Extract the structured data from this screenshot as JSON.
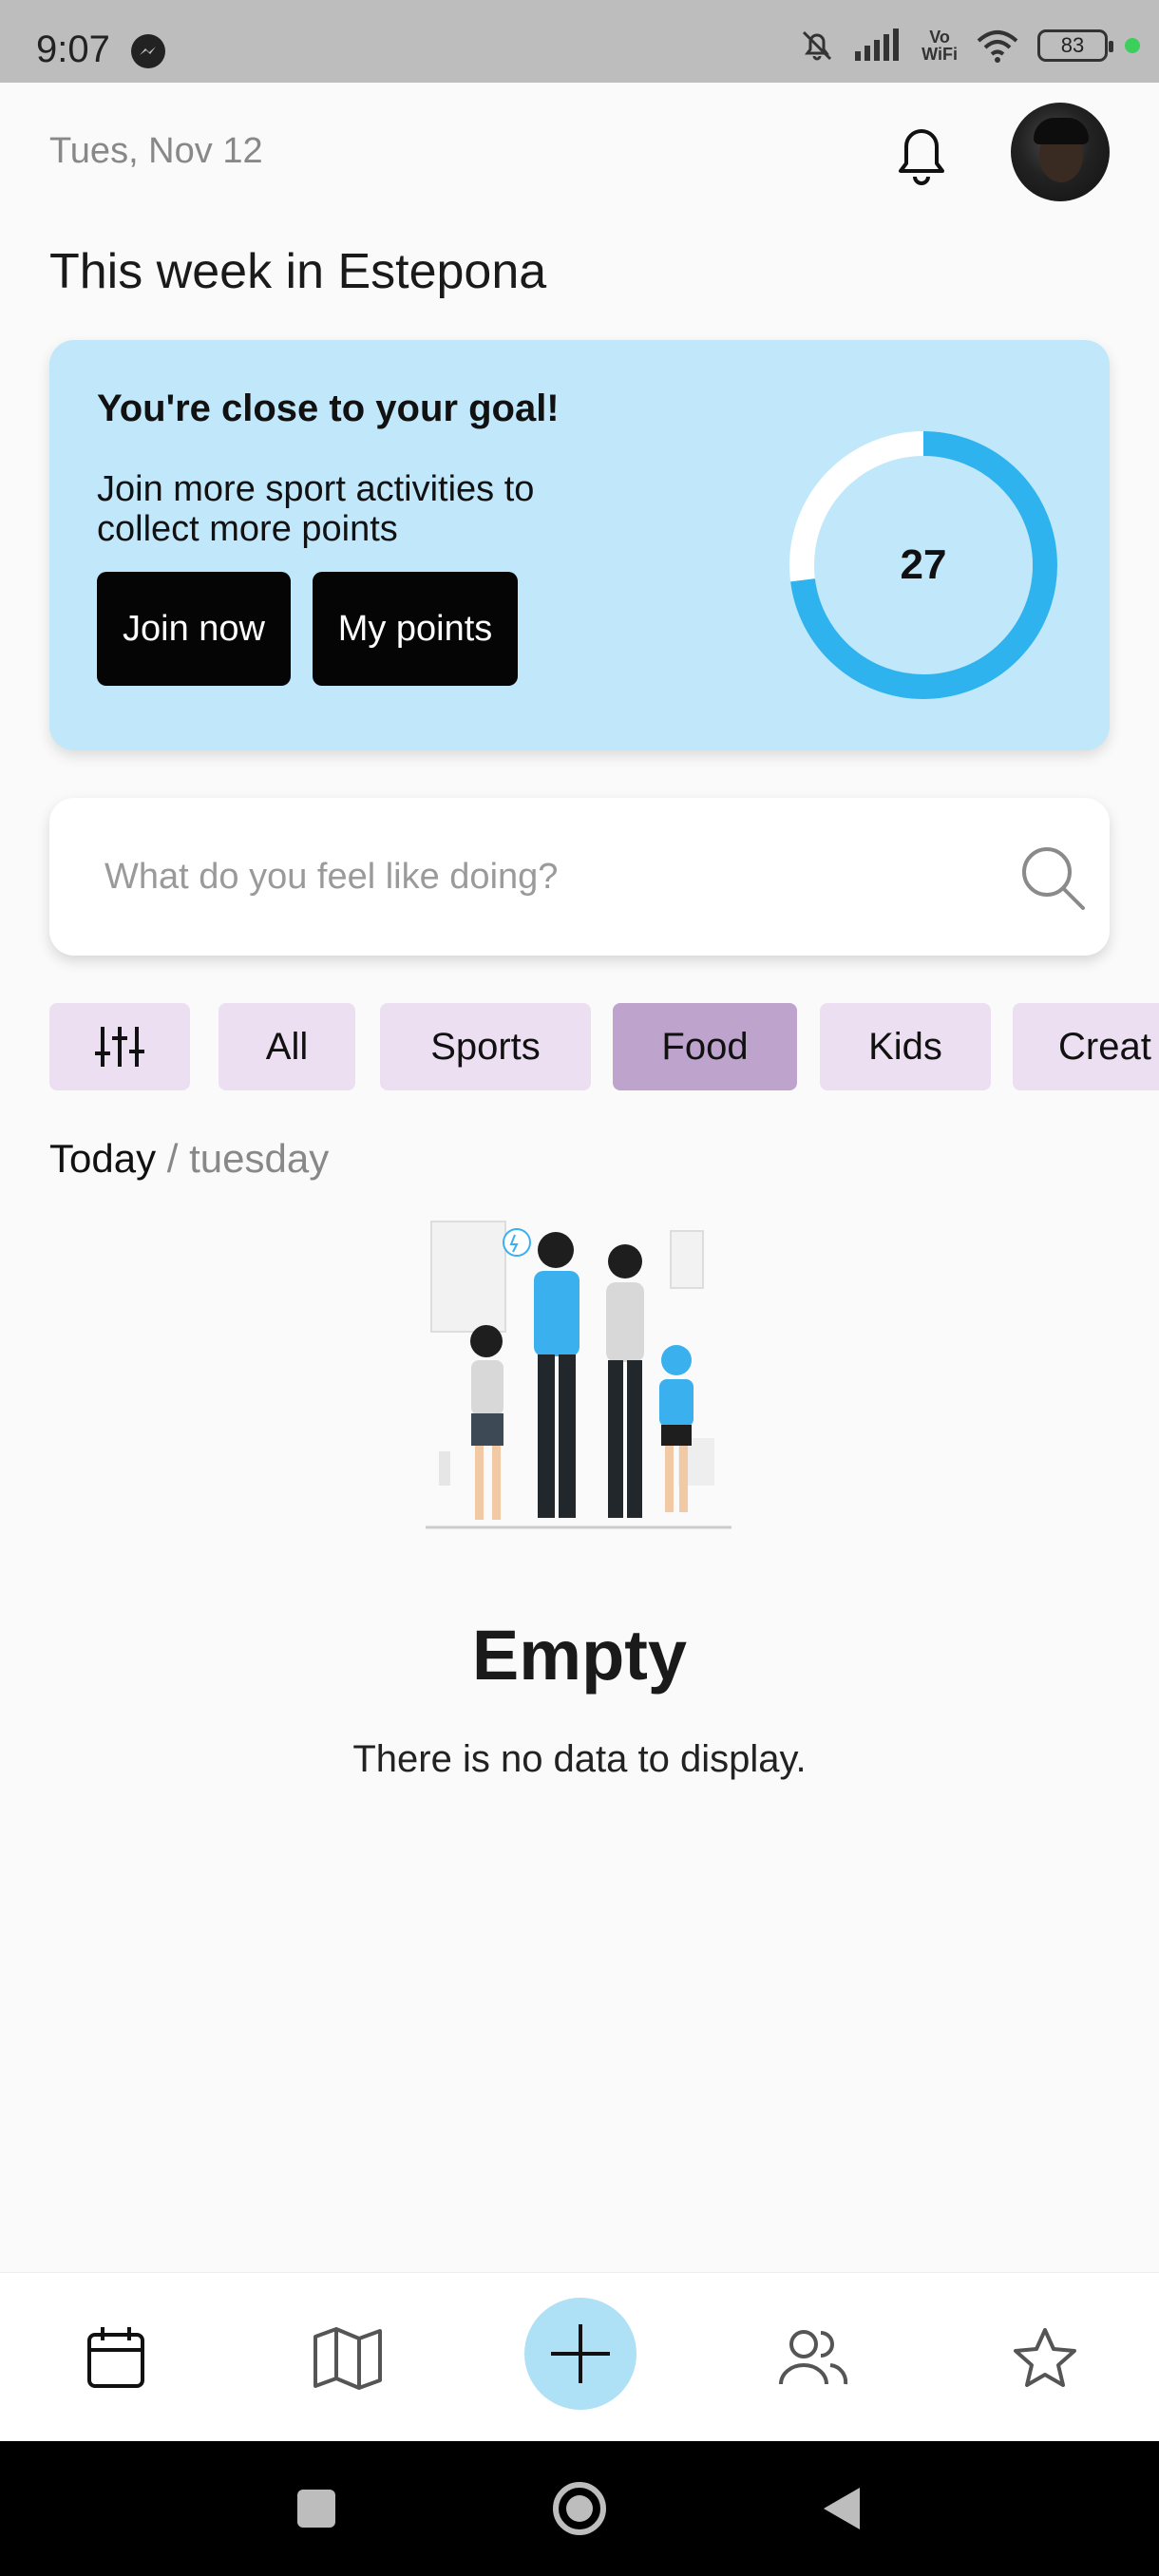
{
  "status_bar": {
    "time": "9:07",
    "vowifi_top": "Vo",
    "vowifi_bottom": "WiFi",
    "battery": "83"
  },
  "header": {
    "date": "Tues, Nov 12",
    "title": "This week in Estepona"
  },
  "goal_card": {
    "title": "You're close to your goal!",
    "text": "Join more sport activities to collect more points",
    "join_label": "Join now",
    "points_label": "My points",
    "points_value": "27",
    "progress_fraction": 0.73,
    "accent_color": "#2fb3ee"
  },
  "search": {
    "placeholder": "What do you feel like doing?"
  },
  "chips": [
    {
      "label": ""
    },
    {
      "label": "All"
    },
    {
      "label": "Sports"
    },
    {
      "label": "Food"
    },
    {
      "label": "Kids"
    },
    {
      "label": "Creat"
    }
  ],
  "active_chip": "Food",
  "day": {
    "today": "Today",
    "separator": " / ",
    "weekday": "tuesday"
  },
  "empty": {
    "title": "Empty",
    "text": "There is no data to display."
  },
  "bottom_nav": {
    "items": [
      "calendar-icon",
      "map-icon",
      "plus-icon",
      "users-icon",
      "star-icon"
    ]
  }
}
